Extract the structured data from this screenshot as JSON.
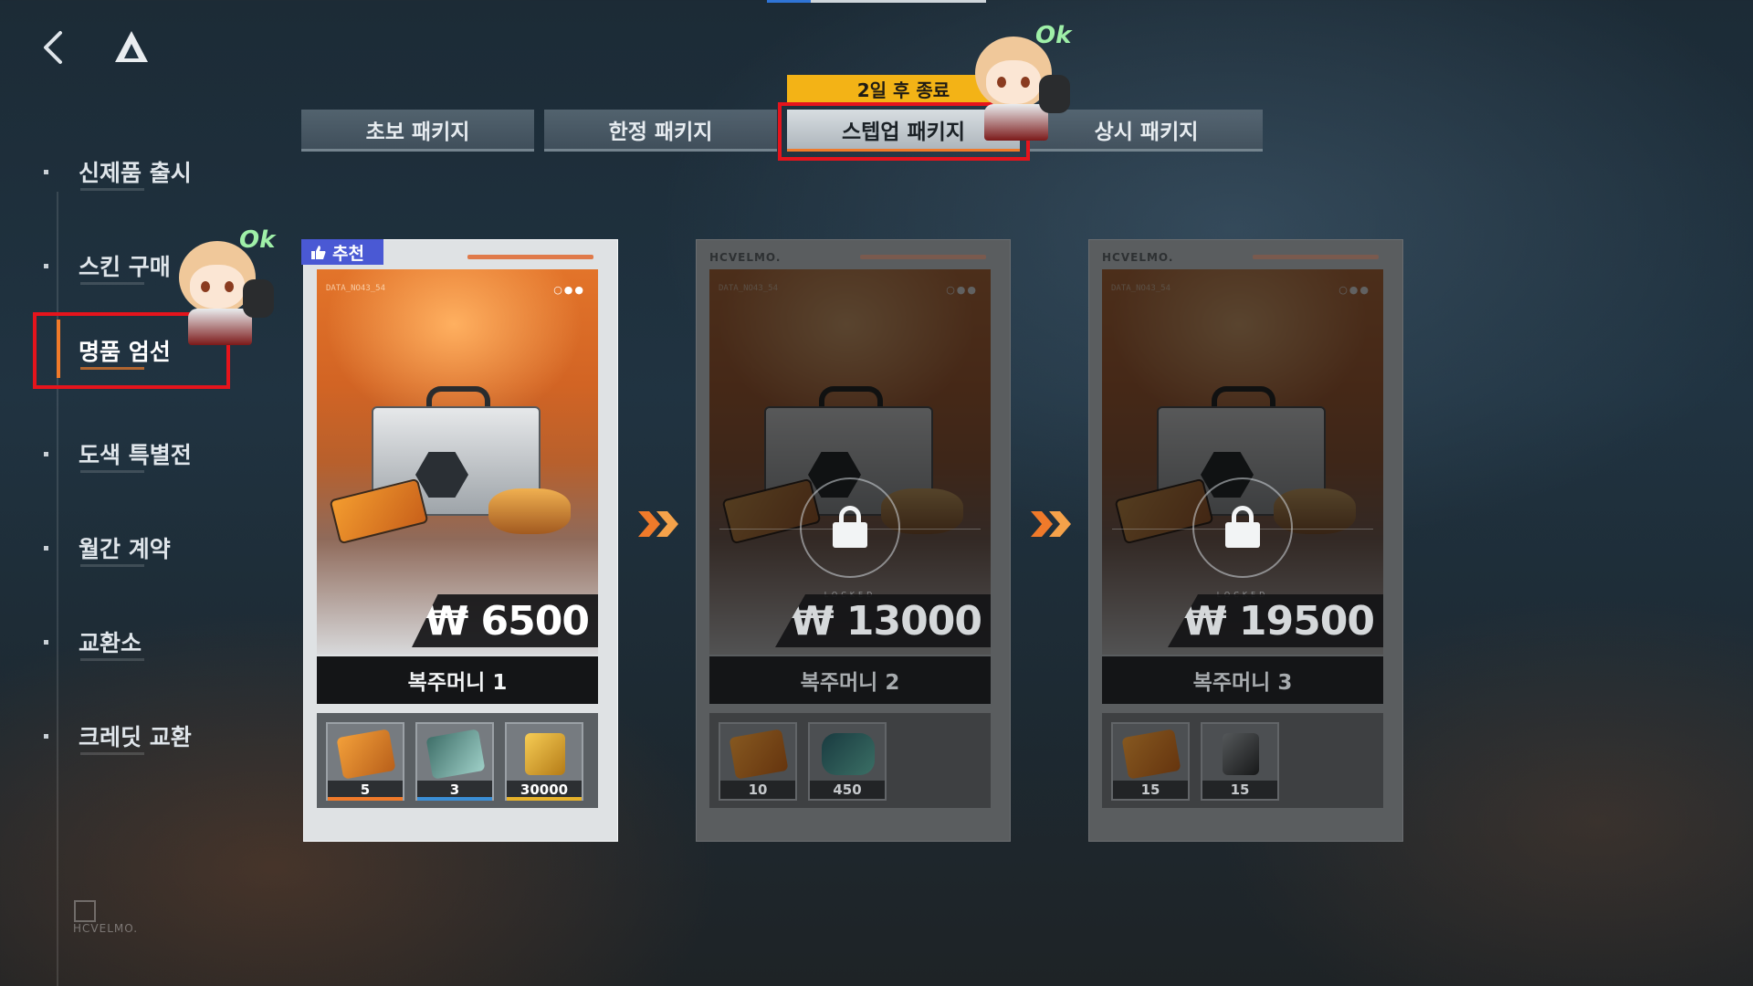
{
  "nav": {
    "back_icon": "chevron-left-icon",
    "logo_icon": "triangle-logo-icon"
  },
  "sidebar": {
    "items": [
      {
        "label": "신제품 출시"
      },
      {
        "label": "스킨 구매"
      },
      {
        "label": "명품 엄선"
      },
      {
        "label": "도색 특별전"
      },
      {
        "label": "월간 계약"
      },
      {
        "label": "교환소"
      },
      {
        "label": "크레딧 교환"
      }
    ],
    "active_index": 2,
    "footer_brand": "HCVELMO."
  },
  "tabs": {
    "timer": "2일 후 종료",
    "items": [
      {
        "label": "초보 패키지"
      },
      {
        "label": "한정 패키지"
      },
      {
        "label": "스텝업 패키지"
      },
      {
        "label": "상시 패키지"
      }
    ],
    "active_index": 2
  },
  "badge": {
    "label": "추천",
    "icon": "thumbs-up-icon"
  },
  "cards": [
    {
      "brand": "",
      "data_text": "DATA_NO43_54",
      "price": "₩ 6500",
      "name": "복주머니 1",
      "locked": false,
      "items": [
        {
          "icon": "orange-card-icon",
          "qty": "5",
          "color": "#f07a2a"
        },
        {
          "icon": "chip-key-icon",
          "qty": "3",
          "color": "#3b8fd6"
        },
        {
          "icon": "gold-bar-icon",
          "qty": "30000",
          "color": "#e6b22b"
        }
      ]
    },
    {
      "brand": "HCVELMO.",
      "data_text": "DATA_NO43_54",
      "price": "₩ 13000",
      "name": "복주머니 2",
      "locked": true,
      "lock_text": "LOCKED",
      "items": [
        {
          "icon": "orange-card-icon",
          "qty": "10",
          "color": "#8a6a4a"
        },
        {
          "icon": "teal-crystal-icon",
          "qty": "450",
          "color": "#4a6a6a"
        }
      ]
    },
    {
      "brand": "HCVELMO.",
      "data_text": "DATA_NO43_54",
      "price": "₩ 19500",
      "name": "복주머니 3",
      "locked": true,
      "lock_text": "LOCKED",
      "items": [
        {
          "icon": "orange-card-icon",
          "qty": "15",
          "color": "#8a6a4a"
        },
        {
          "icon": "dark-chip-icon",
          "qty": "15",
          "color": "#5a5a5a"
        }
      ]
    }
  ],
  "mascot_text": "Ok",
  "colors": {
    "accent": "#f07a2a",
    "highlight": "#e5141c",
    "timer": "#f3b316",
    "badge": "#4a59d4"
  }
}
